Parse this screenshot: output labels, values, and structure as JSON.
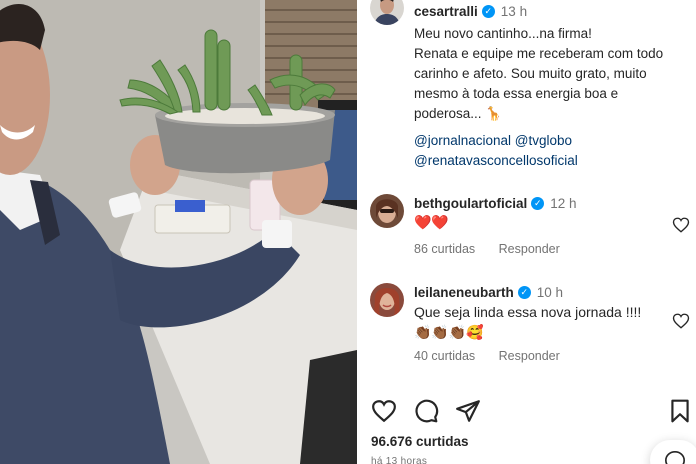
{
  "post": {
    "author": "cesartralli",
    "time": "13 h",
    "caption": "Meu novo cantinho...na firma!\nRenata e equipe me receberam com todo carinho e afeto. Sou muito grato, muito mesmo à toda essa energia boa e poderosa... 🦒",
    "mentions": [
      "@jornalnacional @tvglobo",
      "@renatavasconcellosoficial"
    ],
    "likes": "96.676 curtidas",
    "date": "há 13 horas"
  },
  "comments": [
    {
      "username": "bethgoulartoficial",
      "time": "12 h",
      "text": "❤️❤️",
      "likes": "86 curtidas",
      "reply": "Responder"
    },
    {
      "username": "leilaneneubarth",
      "time": "10 h",
      "text": "Que seja linda essa nova jornada !!!!",
      "emojis": "👏🏾👏🏾👏🏾🥰",
      "likes": "40 curtidas",
      "reply": "Responder"
    }
  ],
  "icons": {
    "verified": "✓",
    "like": "heart-icon",
    "comment": "comment-icon",
    "share": "share-icon",
    "save": "bookmark-icon"
  },
  "colors": {
    "link": "#00376b",
    "verified": "#0095f6",
    "muted": "#737373"
  }
}
